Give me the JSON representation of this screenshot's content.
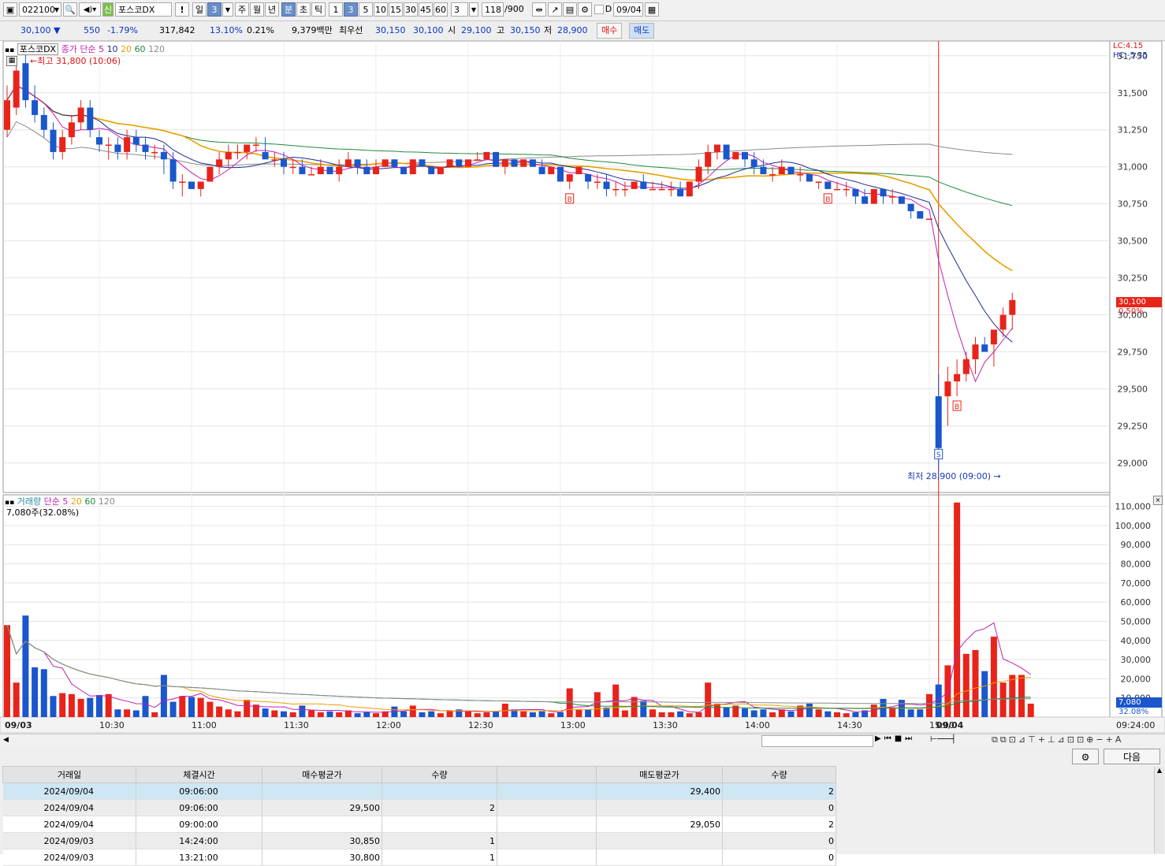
{
  "toolbar": {
    "code": "022100",
    "credit_badge": "신",
    "stock_name": "포스코DX",
    "alert": "!",
    "periods": [
      "일",
      "3",
      "주",
      "월",
      "년",
      "분",
      "초",
      "틱"
    ],
    "minute_options": [
      "1",
      "3",
      "5",
      "10",
      "15",
      "30",
      "45",
      "60"
    ],
    "custom_value": "3",
    "count": "118",
    "count_total": "/900",
    "date_checkbox_label": "D",
    "date": "09/04"
  },
  "info": {
    "price": "30,100",
    "change": "550",
    "change_pct": "-1.79%",
    "volume": "317,842",
    "turnover": "13.10%",
    "ratio": "0.21%",
    "amount": "9,379백만",
    "best_label": "최우선",
    "ask": "30,150",
    "bid": "30,100",
    "open_label": "시",
    "open": "29,100",
    "high_label": "고",
    "high": "30,150",
    "low_label": "저",
    "low": "28,900",
    "buy_button": "매수",
    "sell_button": "매도"
  },
  "price_legend": {
    "name": "포스코DX",
    "label": "종가 단순",
    "ma": [
      "5",
      "10",
      "20",
      "60",
      "120"
    ],
    "high_marker": "최고 31,800 (10:06)",
    "low_marker": "최저 28,900 (09:00)",
    "lc": "LC:4.15",
    "hc": "HC:-5.35",
    "current_price": "30,100",
    "current_pct": "0.50%"
  },
  "volume_legend": {
    "label": "거래량",
    "ma_label": "단순",
    "ma": [
      "5",
      "20",
      "60",
      "120"
    ],
    "current": "7,080주(32.08%)",
    "current_tag": "7,080",
    "current_pct": "32.08%"
  },
  "colors": {
    "up": "#e8231a",
    "down": "#1a56cc",
    "ma5": "#c21fb5",
    "ma10": "#1d2b8f",
    "ma20": "#e8a000",
    "ma60": "#1f8a3c",
    "ma120": "#8a8a8a"
  },
  "chart_data": {
    "type": "candlestick",
    "interval": "3분",
    "price_axis": [
      "31,750",
      "31,500",
      "31,250",
      "31,000",
      "30,750",
      "30,500",
      "30,250",
      "30,000",
      "29,750",
      "29,500",
      "29,250",
      "29,000"
    ],
    "volume_axis": [
      "110,000",
      "100,000",
      "90,000",
      "80,000",
      "70,000",
      "60,000",
      "50,000",
      "40,000",
      "30,000",
      "20,000",
      "10,000"
    ],
    "time_axis": [
      "09/03",
      "10:30",
      "11:00",
      "11:30",
      "12:00",
      "12:30",
      "13:00",
      "13:30",
      "14:00",
      "14:30",
      "15:00",
      "09/04",
      "09:24:00"
    ],
    "ohlc": [
      [
        31250,
        31550,
        31200,
        31450
      ],
      [
        31400,
        31700,
        31350,
        31650
      ],
      [
        31700,
        31800,
        31400,
        31450
      ],
      [
        31450,
        31550,
        31300,
        31350
      ],
      [
        31350,
        31400,
        31200,
        31250
      ],
      [
        31250,
        31300,
        31050,
        31100
      ],
      [
        31100,
        31250,
        31050,
        31200
      ],
      [
        31200,
        31350,
        31150,
        31300
      ],
      [
        31300,
        31450,
        31250,
        31400
      ],
      [
        31400,
        31450,
        31200,
        31250
      ],
      [
        31200,
        31250,
        31100,
        31150
      ],
      [
        31150,
        31200,
        31050,
        31150
      ],
      [
        31150,
        31200,
        31050,
        31100
      ],
      [
        31100,
        31250,
        31050,
        31200
      ],
      [
        31200,
        31250,
        31100,
        31150
      ],
      [
        31150,
        31200,
        31050,
        31100
      ],
      [
        31100,
        31150,
        31050,
        31100
      ],
      [
        31100,
        31150,
        30950,
        31050
      ],
      [
        31050,
        31100,
        30850,
        30900
      ],
      [
        30900,
        30950,
        30800,
        30900
      ],
      [
        30900,
        30900,
        30850,
        30850
      ],
      [
        30850,
        30900,
        30800,
        30900
      ],
      [
        30900,
        31000,
        30900,
        31000
      ],
      [
        31000,
        31100,
        30950,
        31050
      ],
      [
        31050,
        31150,
        31000,
        31100
      ],
      [
        31100,
        31150,
        31050,
        31100
      ],
      [
        31100,
        31150,
        31050,
        31150
      ],
      [
        31150,
        31200,
        31100,
        31150
      ],
      [
        31100,
        31200,
        31100,
        31050
      ],
      [
        31050,
        31100,
        31000,
        31050
      ],
      [
        31050,
        31100,
        30950,
        31000
      ],
      [
        31000,
        31050,
        30950,
        31000
      ],
      [
        31000,
        31050,
        30950,
        30950
      ],
      [
        30950,
        31000,
        30950,
        30950
      ],
      [
        30950,
        31050,
        30950,
        31000
      ],
      [
        31000,
        31000,
        30950,
        30950
      ],
      [
        30950,
        31050,
        30900,
        31000
      ],
      [
        31000,
        31100,
        31000,
        31050
      ],
      [
        31050,
        31050,
        30950,
        31000
      ],
      [
        31000,
        31050,
        30950,
        30950
      ],
      [
        30950,
        31050,
        30950,
        31000
      ],
      [
        31000,
        31050,
        31000,
        31050
      ],
      [
        31050,
        31050,
        31000,
        31000
      ],
      [
        31000,
        31000,
        30950,
        30950
      ],
      [
        30950,
        31050,
        30950,
        31050
      ],
      [
        31050,
        31050,
        31000,
        31000
      ],
      [
        31000,
        31000,
        30950,
        30950
      ],
      [
        30950,
        31000,
        30950,
        31000
      ],
      [
        31000,
        31050,
        31000,
        31050
      ],
      [
        31050,
        31050,
        31000,
        31000
      ],
      [
        31000,
        31050,
        31000,
        31050
      ],
      [
        31050,
        31100,
        31050,
        31050
      ],
      [
        31050,
        31100,
        31050,
        31100
      ],
      [
        31100,
        31100,
        31000,
        31000
      ],
      [
        31000,
        31050,
        30950,
        31050
      ],
      [
        31050,
        31050,
        31000,
        31000
      ],
      [
        31000,
        31050,
        31000,
        31050
      ],
      [
        31050,
        31050,
        31000,
        31000
      ],
      [
        31000,
        31050,
        30950,
        30950
      ],
      [
        30950,
        31000,
        30950,
        31000
      ],
      [
        31000,
        31000,
        30900,
        30900
      ],
      [
        30900,
        30950,
        30850,
        30950
      ],
      [
        30950,
        31000,
        30950,
        31000
      ],
      [
        30950,
        30950,
        30850,
        30900
      ],
      [
        30900,
        30950,
        30850,
        30900
      ],
      [
        30900,
        30950,
        30800,
        30850
      ],
      [
        30850,
        30900,
        30800,
        30850
      ],
      [
        30850,
        30900,
        30800,
        30850
      ],
      [
        30850,
        30900,
        30850,
        30900
      ],
      [
        30900,
        30950,
        30850,
        30850
      ],
      [
        30850,
        30900,
        30850,
        30850
      ],
      [
        30850,
        30900,
        30850,
        30850
      ],
      [
        30850,
        30900,
        30800,
        30850
      ],
      [
        30850,
        30900,
        30800,
        30800
      ],
      [
        30800,
        30900,
        30800,
        30900
      ],
      [
        30900,
        31050,
        30850,
        31000
      ],
      [
        31000,
        31150,
        30950,
        31100
      ],
      [
        31100,
        31150,
        31050,
        31150
      ],
      [
        31150,
        31150,
        31050,
        31050
      ],
      [
        31050,
        31100,
        31050,
        31100
      ],
      [
        31100,
        31100,
        31000,
        31050
      ],
      [
        31050,
        31100,
        30950,
        31000
      ],
      [
        31000,
        31050,
        30950,
        30950
      ],
      [
        30950,
        31000,
        30900,
        30950
      ],
      [
        30950,
        31050,
        30950,
        31000
      ],
      [
        31000,
        31000,
        30950,
        30950
      ],
      [
        30950,
        31000,
        30900,
        30950
      ],
      [
        30950,
        30950,
        30900,
        30900
      ],
      [
        30900,
        30900,
        30850,
        30900
      ],
      [
        30900,
        30900,
        30850,
        30850
      ],
      [
        30850,
        30900,
        30850,
        30850
      ],
      [
        30850,
        30900,
        30800,
        30850
      ],
      [
        30850,
        30850,
        30750,
        30800
      ],
      [
        30800,
        30850,
        30750,
        30750
      ],
      [
        30750,
        30850,
        30750,
        30850
      ],
      [
        30850,
        30850,
        30750,
        30800
      ],
      [
        30800,
        30850,
        30750,
        30800
      ],
      [
        30800,
        30800,
        30750,
        30750
      ],
      [
        30750,
        30750,
        30650,
        30700
      ],
      [
        30700,
        30700,
        30650,
        30650
      ],
      [
        30650,
        30650,
        30650,
        30650
      ],
      [
        29450,
        29600,
        28900,
        29100
      ],
      [
        29450,
        29650,
        29250,
        29550
      ],
      [
        29550,
        29700,
        29450,
        29600
      ],
      [
        29600,
        29750,
        29550,
        29700
      ],
      [
        29700,
        29850,
        29600,
        29800
      ],
      [
        29800,
        29850,
        29750,
        29750
      ],
      [
        29800,
        29900,
        29650,
        29900
      ],
      [
        29900,
        30050,
        29850,
        30000
      ],
      [
        30000,
        30150,
        29900,
        30100
      ]
    ],
    "buy_sell_markers": [
      {
        "type": "B",
        "index": 61
      },
      {
        "type": "B",
        "index": 89
      },
      {
        "type": "S",
        "index": 101
      },
      {
        "type": "B",
        "index": 103
      }
    ],
    "volume": [
      48000,
      18000,
      53000,
      26000,
      25000,
      11000,
      12500,
      12000,
      9500,
      10000,
      11500,
      12000,
      4000,
      4000,
      3500,
      11000,
      2500,
      22000,
      8000,
      11000,
      10500,
      10000,
      8000,
      5500,
      4000,
      3000,
      9000,
      6500,
      4500,
      3500,
      3000,
      2500,
      6000,
      3500,
      2500,
      3000,
      2500,
      3500,
      2000,
      2500,
      2000,
      3000,
      5500,
      3000,
      6000,
      2500,
      3000,
      2000,
      3500,
      4000,
      3000,
      2000,
      2500,
      3000,
      7000,
      4000,
      3000,
      2500,
      3000,
      2000,
      2500,
      15000,
      4000,
      4000,
      13000,
      5000,
      17000,
      3500,
      10500,
      8500,
      4000,
      2500,
      2500,
      3000,
      2000,
      2500,
      18000,
      7000,
      5000,
      6000,
      4500,
      3500,
      4000,
      2500,
      4000,
      3000,
      6000,
      7000,
      4000,
      3000,
      2500,
      2000,
      2500,
      3500,
      6500,
      9500,
      5000,
      9000,
      4000,
      4000,
      12000,
      17000,
      27000,
      112000,
      33000,
      35000,
      24000,
      42000,
      18000,
      22000,
      22000,
      7000
    ]
  },
  "trades": {
    "columns": [
      "거래일",
      "체결시간",
      "매수평균가",
      "수량",
      "",
      "매도평균가",
      "수량"
    ],
    "rows": [
      [
        "2024/09/04",
        "09:06:00",
        "",
        "",
        "",
        "29,400",
        "2"
      ],
      [
        "2024/09/04",
        "09:06:00",
        "29,500",
        "2",
        "",
        "",
        "0"
      ],
      [
        "2024/09/04",
        "09:00:00",
        "",
        "",
        "",
        "29,050",
        "2"
      ],
      [
        "2024/09/03",
        "14:24:00",
        "30,850",
        "1",
        "",
        "",
        "0"
      ],
      [
        "2024/09/03",
        "13:21:00",
        "30,800",
        "1",
        "",
        "",
        "0"
      ]
    ],
    "settings_button": "⚙",
    "next_button": "다음"
  }
}
